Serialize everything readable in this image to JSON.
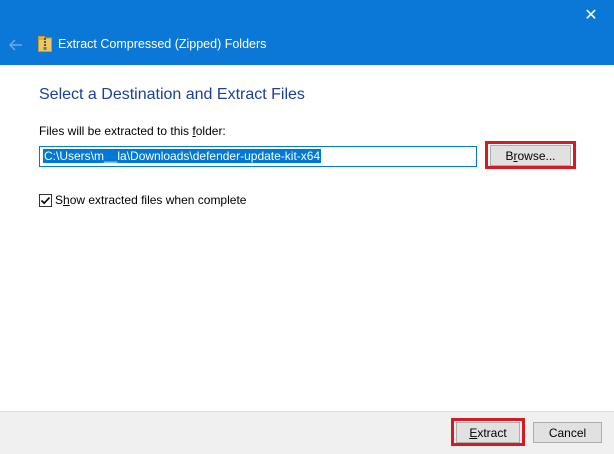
{
  "window": {
    "title": "Extract Compressed (Zipped) Folders",
    "close_glyph": "✕",
    "back_icon": "back-arrow-icon",
    "title_icon": "zip-folder-icon",
    "accent_color": "#0b78d7"
  },
  "main": {
    "heading": "Select a Destination and Extract Files",
    "destination_label_pre": "Files will be extracted to this ",
    "destination_label_key": "f",
    "destination_label_post": "older:",
    "destination_path": "C:\\Users\\m__la\\Downloads\\defender-update-kit-x64",
    "browse_pre": "B",
    "browse_key": "r",
    "browse_post": "owse...",
    "show_files_checked": true,
    "show_files_pre": "S",
    "show_files_key": "h",
    "show_files_post": "ow extracted files when complete"
  },
  "footer": {
    "extract_pre": "",
    "extract_key": "E",
    "extract_post": "xtract",
    "cancel_label": "Cancel"
  },
  "highlight_color": "#d71921"
}
